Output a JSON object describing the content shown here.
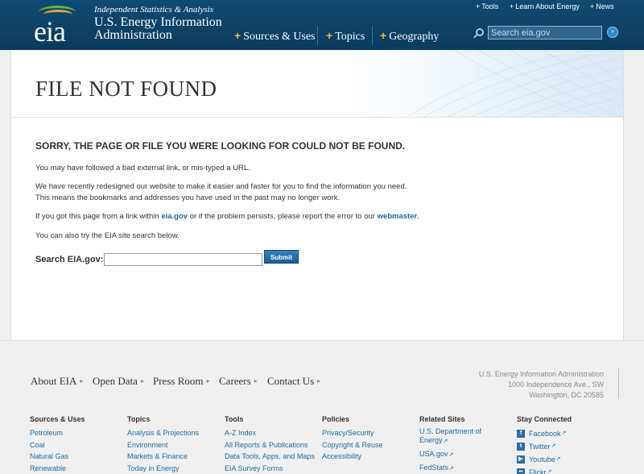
{
  "header": {
    "logo_text": "eia",
    "tagline": "Independent Statistics & Analysis",
    "agency_line1": "U.S. Energy Information",
    "agency_line2": "Administration",
    "nav": [
      "Sources & Uses",
      "Topics",
      "Geography"
    ],
    "utility_links": [
      "Tools",
      "Learn About Energy",
      "News"
    ],
    "search_placeholder": "Search eia.gov",
    "search_go": "»"
  },
  "main": {
    "page_title": "FILE NOT FOUND",
    "headline": "SORRY, THE PAGE OR FILE YOU WERE LOOKING FOR COULD NOT BE FOUND.",
    "p1": "You may have followed a bad external link, or mis-typed a URL.",
    "p2_line1": "We have recently redesigned our website to make it easier and faster for you to find the information you need.",
    "p2_line2": "This means the bookmarks and addresses you have used in the past may no longer work.",
    "p3_before": "If you got this page from a link within ",
    "p3_link1": "eia.gov",
    "p3_middle": " or if the problem persists, please report the error to our ",
    "p3_link2": "webmaster",
    "p3_after": ".",
    "p4": "You can also try the EIA site search below.",
    "search_label": "Search EIA.gov:",
    "submit_label": "Submit"
  },
  "footer": {
    "nav": [
      "About EIA",
      "Open Data",
      "Press Room",
      "Careers",
      "Contact Us"
    ],
    "address": [
      "U.S. Energy Information Administration",
      "1000 Independence Ave., SW",
      "Washington, DC 20585"
    ],
    "columns": [
      {
        "head": "Sources & Uses",
        "links": [
          "Petroleum",
          "Coal",
          "Natural Gas",
          "Renewable"
        ]
      },
      {
        "head": "Topics",
        "links": [
          "Analysis & Projections",
          "Environment",
          "Markets & Finance",
          "Today in Energy"
        ]
      },
      {
        "head": "Tools",
        "links": [
          "A-Z Index",
          "All Reports & Publications",
          "Data Tools, Apps, and Maps",
          "EIA Survey Forms"
        ]
      },
      {
        "head": "Policies",
        "links": [
          "Privacy/Security",
          "Copyright & Reuse",
          "Accessibility"
        ]
      },
      {
        "head": "Related Sites",
        "links": [
          "U.S. Department of Energy",
          "USA.gov",
          "FedStats"
        ]
      },
      {
        "head": "Stay Connected",
        "links": [
          "Facebook",
          "Twitter",
          "Youtube",
          "Flickr"
        ]
      }
    ]
  },
  "colors": {
    "header_bg": "#0a3b5e",
    "accent_plus": "#f5c12e",
    "link": "#1a6aa5",
    "submit_bg": "#1a5e93"
  }
}
